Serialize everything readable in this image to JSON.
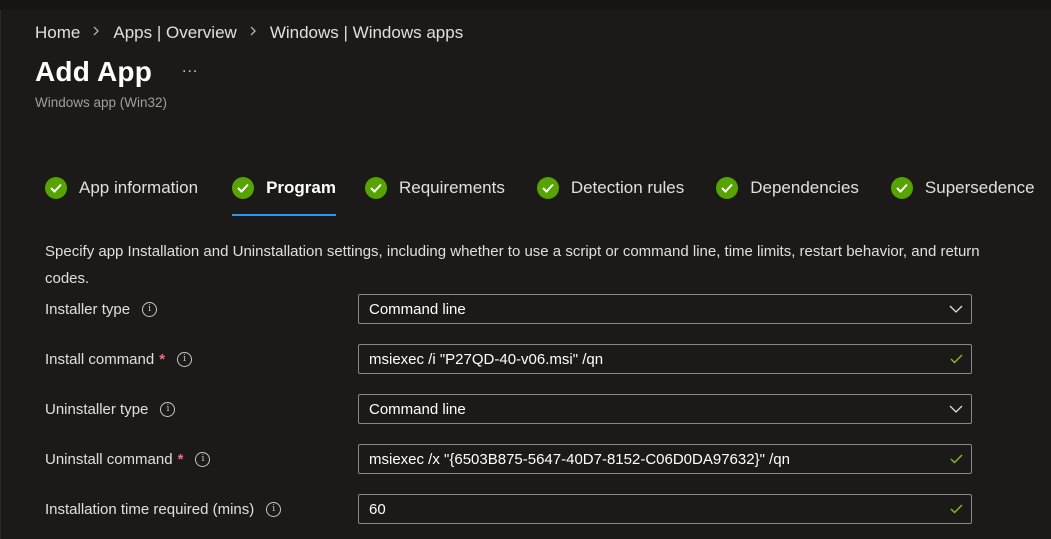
{
  "breadcrumb": {
    "items": [
      "Home",
      "Apps | Overview",
      "Windows | Windows apps"
    ]
  },
  "header": {
    "title": "Add App",
    "more": "...",
    "subtitle": "Windows app (Win32)"
  },
  "tabs": [
    {
      "label": "App information",
      "status": "complete",
      "active": false
    },
    {
      "label": "Program",
      "status": "complete",
      "active": true
    },
    {
      "label": "Requirements",
      "status": "complete",
      "active": false
    },
    {
      "label": "Detection rules",
      "status": "complete",
      "active": false
    },
    {
      "label": "Dependencies",
      "status": "complete",
      "active": false
    },
    {
      "label": "Supersedence",
      "status": "complete",
      "active": false
    }
  ],
  "description": "Specify app Installation and Uninstallation settings, including whether to use a script or command line, time limits, restart behavior, and return codes.",
  "form": {
    "installer_type": {
      "label": "Installer type",
      "required": false,
      "value": "Command line",
      "control": "dropdown"
    },
    "install_command": {
      "label": "Install command",
      "required": true,
      "value": "msiexec /i \"P27QD-40-v06.msi\" /qn",
      "control": "text",
      "valid": true
    },
    "uninstaller_type": {
      "label": "Uninstaller type",
      "required": false,
      "value": "Command line",
      "control": "dropdown"
    },
    "uninstall_command": {
      "label": "Uninstall command",
      "required": true,
      "value": "msiexec /x \"{6503B875-5647-40D7-8152-C06D0DA97632}\" /qn",
      "control": "text",
      "valid": true
    },
    "install_time": {
      "label": "Installation time required (mins)",
      "required": false,
      "value": "60",
      "control": "text",
      "valid": true
    }
  },
  "symbols": {
    "required_marker": "*",
    "info_glyph": "i"
  },
  "colors": {
    "background": "#1b1a19",
    "check_green": "#57a300",
    "valid_check": "#8cbd18",
    "active_underline": "#2899f5",
    "required_red": "#f1707b"
  }
}
